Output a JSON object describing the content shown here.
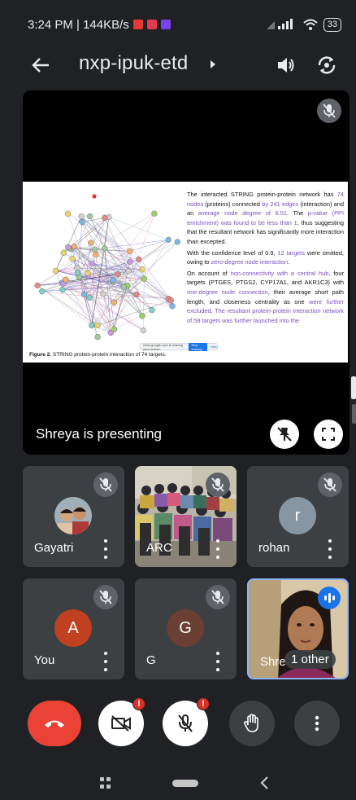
{
  "status_bar": {
    "time_speed": "3:24 PM | 144KB/s",
    "battery": "33"
  },
  "header": {
    "meeting_title": "nxp-ipuk-etd"
  },
  "stage": {
    "presenting_label": "Shreya is presenting",
    "slide": {
      "figure_caption_bold": "Figure 2.",
      "figure_caption_text": " STRING protein-protein interaction of 74 targets.",
      "share_bar_text": "meet.google.com is sharing your screen.",
      "share_bar_stop": "Stop sharing",
      "share_bar_hide": "Hide",
      "paragraph1": [
        {
          "t": "The interacted STRING protein-protein network has ",
          "h": false
        },
        {
          "t": "74 nodes",
          "h": true
        },
        {
          "t": " (proteins) connected ",
          "h": false
        },
        {
          "t": "by 241 edges",
          "h": true
        },
        {
          "t": " (interaction) and an ",
          "h": false
        },
        {
          "t": "average node degree of 6.51",
          "h": true
        },
        {
          "t": ". The ",
          "h": false
        },
        {
          "t": "p-value (PPI enrichment) was found to be less than 1",
          "h": true
        },
        {
          "t": ", thus suggesting that the resultant network has significantly more interaction than excepted.",
          "h": false
        }
      ],
      "paragraph2": [
        {
          "t": "With the confidence level of 0.9, ",
          "h": false
        },
        {
          "t": "12 targets",
          "h": true
        },
        {
          "t": " were omitted, owing to ",
          "h": false
        },
        {
          "t": "zero-degree node interaction",
          "h": true
        },
        {
          "t": ".",
          "h": false
        }
      ],
      "paragraph3": [
        {
          "t": "On account of ",
          "h": false
        },
        {
          "t": "non-connectivity with a central hub",
          "h": true
        },
        {
          "t": ", four targets (PTGES, PTGS2, CYP17A1, and AKR1C3) with ",
          "h": false
        },
        {
          "t": "one-degree node connection",
          "h": true
        },
        {
          "t": ", their average short path length, and closeness centrality as one ",
          "h": false
        },
        {
          "t": "were further excluded",
          "h": true
        },
        {
          "t": ". ",
          "h": false
        },
        {
          "t": "The resultant protein-protein interaction network of 58 targets was further launched into the",
          "h": true
        }
      ]
    }
  },
  "participants": [
    {
      "name": "Gayatri",
      "muted": true
    },
    {
      "name": "ARC",
      "muted": true
    },
    {
      "name": "rohan",
      "muted": true,
      "initial": "r"
    },
    {
      "name": "You",
      "muted": true,
      "initial": "A"
    },
    {
      "name": "G",
      "muted": true,
      "initial": "G"
    },
    {
      "name": "Shre",
      "badge": "1 other",
      "speaking": true
    }
  ],
  "colors": {
    "background": "#202124",
    "tile": "#3c4043",
    "end_call": "#ea4335",
    "avatar_rohan": "#8796a0",
    "avatar_you": "#c0401f",
    "avatar_g": "#6b3f34",
    "highlight_text": "#7b4fc2"
  },
  "controls": {
    "end_call_icon": "phone-hangup-icon",
    "camera_icon": "video-off-icon",
    "mic_icon": "mic-off-icon",
    "hand_icon": "raise-hand-icon",
    "more_icon": "more-vert-icon",
    "alert": "!"
  }
}
